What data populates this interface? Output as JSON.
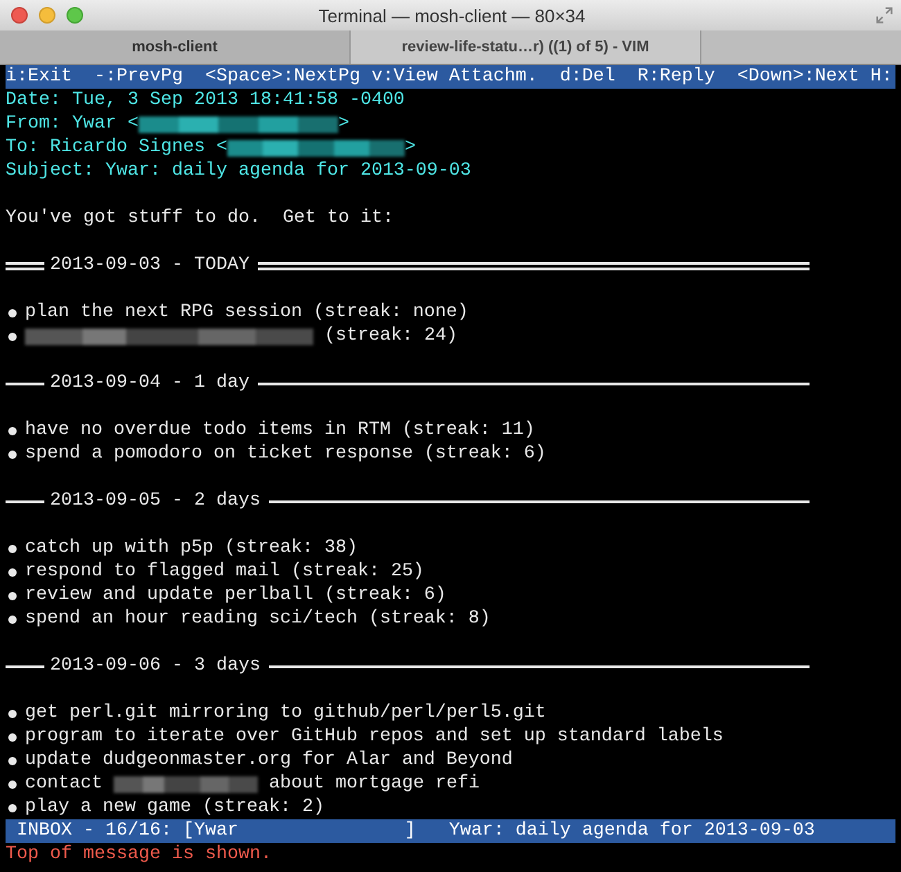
{
  "window": {
    "title": "Terminal — mosh-client — 80×34"
  },
  "tabs": [
    {
      "label": "mosh-client",
      "selected": true
    },
    {
      "label": "review-life-statu…r) ((1) of 5) - VIM",
      "selected": false
    }
  ],
  "help_bar": "i:Exit  -:PrevPg  <Space>:NextPg v:View Attachm.  d:Del  R:Reply  <Down>:Next H:",
  "lines": [
    {
      "kind": "header",
      "segments": [
        {
          "kind": "text",
          "text": "Date: Tue, 3 Sep 2013 18:41:58 -0400"
        }
      ]
    },
    {
      "kind": "header",
      "segments": [
        {
          "kind": "text",
          "text": "From: Ywar <"
        },
        {
          "kind": "redacted"
        },
        {
          "kind": "text",
          "text": ">"
        }
      ]
    },
    {
      "kind": "header",
      "segments": [
        {
          "kind": "text",
          "text": "To: Ricardo Signes <"
        },
        {
          "kind": "redacted"
        },
        {
          "kind": "text",
          "text": ">"
        }
      ]
    },
    {
      "kind": "header",
      "segments": [
        {
          "kind": "text",
          "text": "Subject: Ywar: daily agenda for 2013-09-03"
        }
      ]
    },
    {
      "kind": "blank"
    },
    {
      "kind": "text",
      "segments": [
        {
          "kind": "text",
          "text": "You've got stuff to do.  Get to it:"
        }
      ]
    },
    {
      "kind": "blank"
    },
    {
      "kind": "banner",
      "label": "2013-09-03 - TODAY"
    },
    {
      "kind": "blank"
    },
    {
      "kind": "bullet",
      "segments": [
        {
          "kind": "text",
          "text": "plan the next RPG session (streak: none)"
        }
      ]
    },
    {
      "kind": "bullet",
      "segments": [
        {
          "kind": "redacted"
        },
        {
          "kind": "text",
          "text": " (streak: 24)"
        }
      ]
    },
    {
      "kind": "blank"
    },
    {
      "kind": "divider",
      "label": "2013-09-04 - 1 day"
    },
    {
      "kind": "blank"
    },
    {
      "kind": "bullet",
      "segments": [
        {
          "kind": "text",
          "text": "have no overdue todo items in RTM (streak: 11)"
        }
      ]
    },
    {
      "kind": "bullet",
      "segments": [
        {
          "kind": "text",
          "text": "spend a pomodoro on ticket response (streak: 6)"
        }
      ]
    },
    {
      "kind": "blank"
    },
    {
      "kind": "divider",
      "label": "2013-09-05 - 2 days"
    },
    {
      "kind": "blank"
    },
    {
      "kind": "bullet",
      "segments": [
        {
          "kind": "text",
          "text": "catch up with p5p (streak: 38)"
        }
      ]
    },
    {
      "kind": "bullet",
      "segments": [
        {
          "kind": "text",
          "text": "respond to flagged mail (streak: 25)"
        }
      ]
    },
    {
      "kind": "bullet",
      "segments": [
        {
          "kind": "text",
          "text": "review and update perlball (streak: 6)"
        }
      ]
    },
    {
      "kind": "bullet",
      "segments": [
        {
          "kind": "text",
          "text": "spend an hour reading sci/tech (streak: 8)"
        }
      ]
    },
    {
      "kind": "blank"
    },
    {
      "kind": "divider",
      "label": "2013-09-06 - 3 days"
    },
    {
      "kind": "blank"
    },
    {
      "kind": "bullet",
      "segments": [
        {
          "kind": "text",
          "text": "get perl.git mirroring to github/perl/perl5.git"
        }
      ]
    },
    {
      "kind": "bullet",
      "segments": [
        {
          "kind": "text",
          "text": "program to iterate over GitHub repos and set up standard labels"
        }
      ]
    },
    {
      "kind": "bullet",
      "segments": [
        {
          "kind": "text",
          "text": "update dudgeonmaster.org for Alar and Beyond"
        }
      ]
    },
    {
      "kind": "bullet",
      "segments": [
        {
          "kind": "text",
          "text": "contact "
        },
        {
          "kind": "redacted"
        },
        {
          "kind": "text",
          "text": " about mortgage refi"
        }
      ]
    },
    {
      "kind": "bullet",
      "segments": [
        {
          "kind": "text",
          "text": "play a new game (streak: 2)"
        }
      ]
    }
  ],
  "index_bar": " INBOX - 16/16: [Ywar               ]   Ywar: daily agenda for 2013-09-03",
  "message": "Top of message is shown."
}
